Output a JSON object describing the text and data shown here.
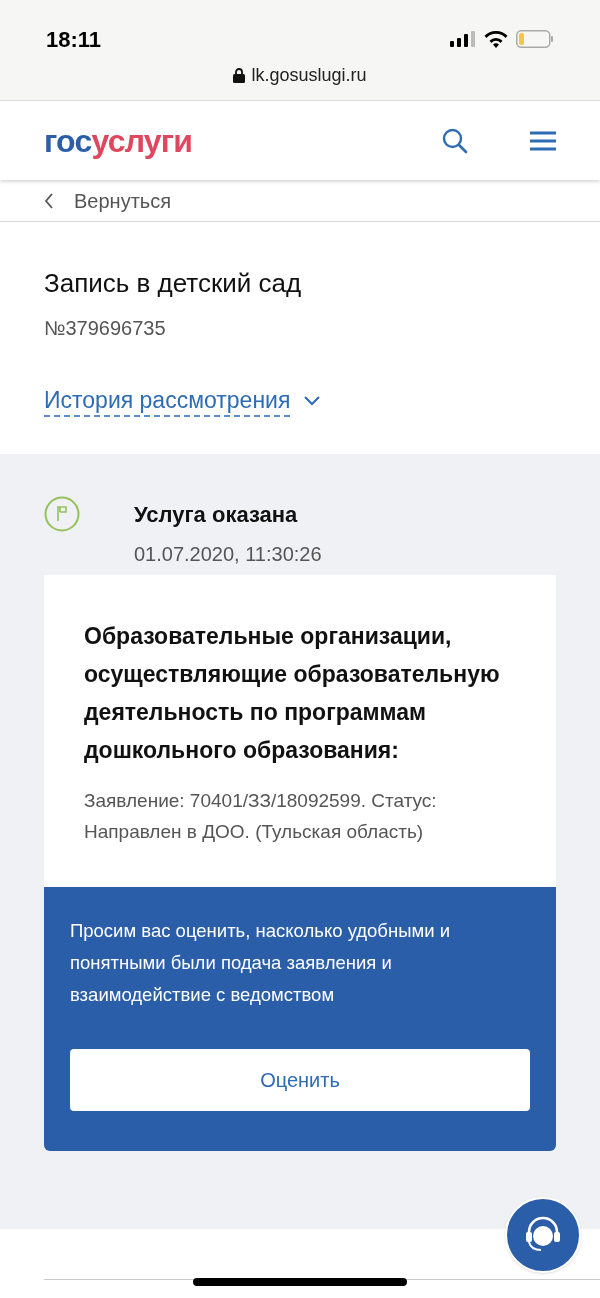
{
  "status_bar": {
    "time": "18:11",
    "url": "lk.gosuslugi.ru"
  },
  "header": {
    "logo": {
      "first": "гос",
      "second": "услуги"
    }
  },
  "back_link": "Вернуться",
  "service": {
    "title": "Запись в детский сад",
    "number": "№379696735",
    "history_link": "История рассмотрения",
    "history_expanded": false
  },
  "event": {
    "title": "Услуга оказана",
    "date": "01.07.2020, 11:30:26"
  },
  "card": {
    "heading": "Образовательные организации, осуществляющие образовательную деятельность по программам дошкольного образования:",
    "text": "Заявление: 70401/ЗЗ/18092599. Статус: Направлен в ДОО. (Тульская область)"
  },
  "rating": {
    "text": "Просим вас оценить, насколько удобными и понятными были подача заявления и взаимодействие с ведомством",
    "button": "Оценить"
  }
}
